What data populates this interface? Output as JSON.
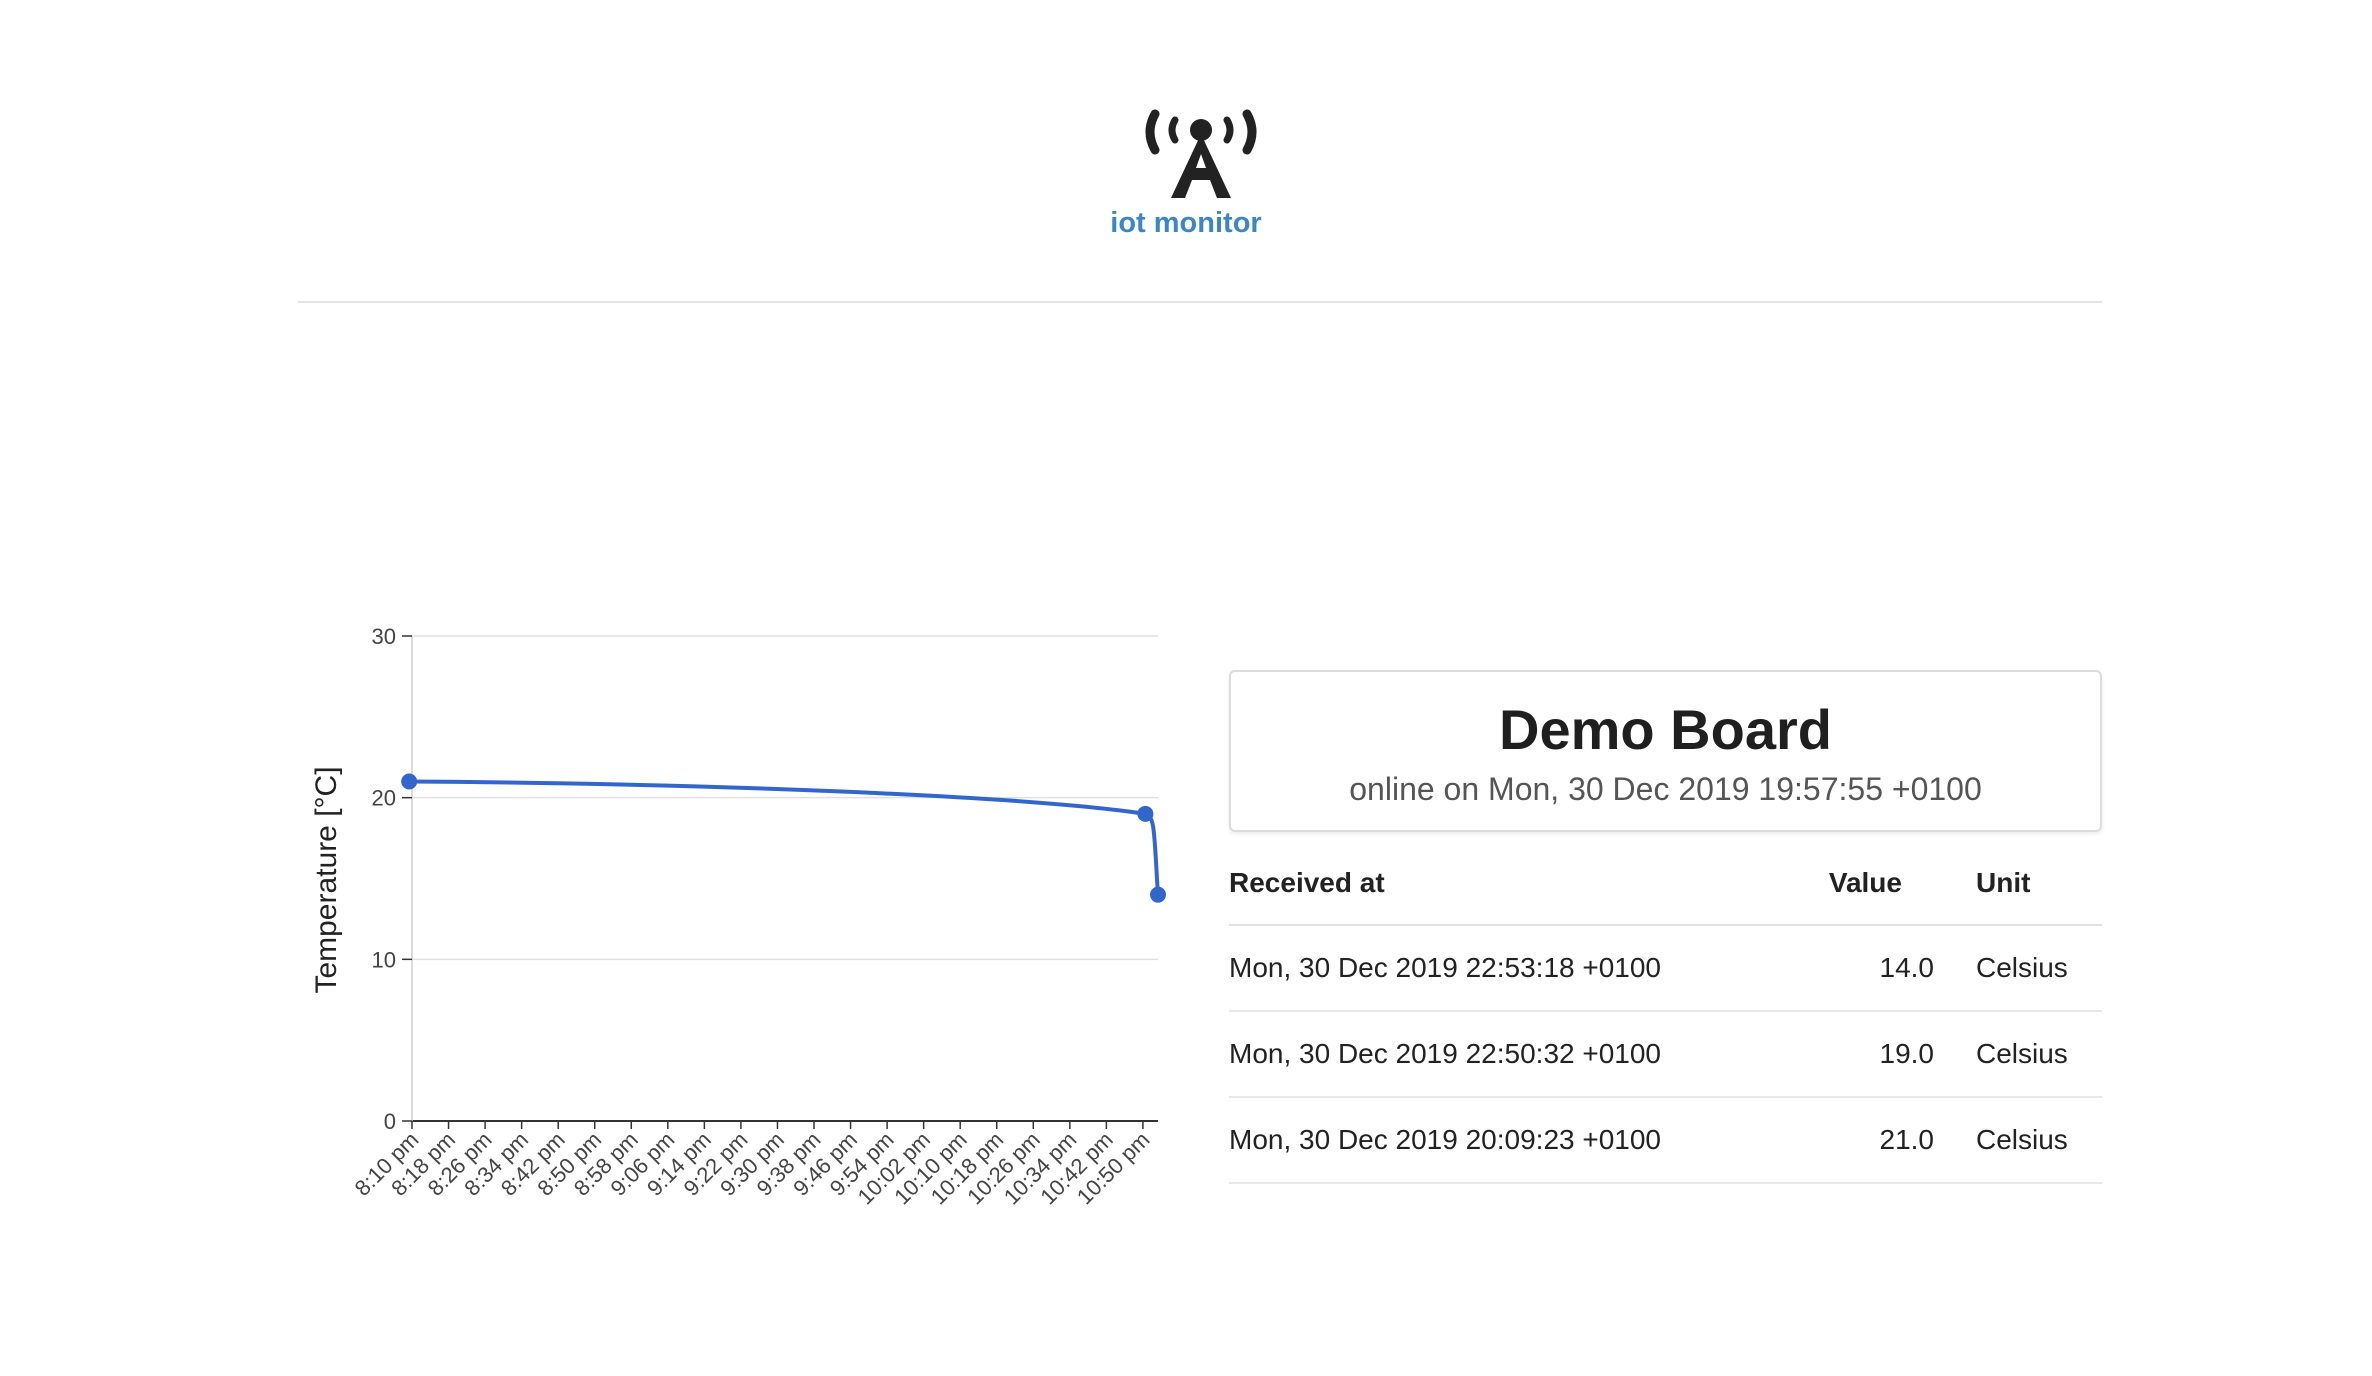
{
  "header": {
    "brand": "iot monitor",
    "logo_icon": "antenna-tower-icon",
    "accent_color": "#3d85c6"
  },
  "device": {
    "name": "Demo Board",
    "status": "online on Mon, 30 Dec 2019 19:57:55 +0100"
  },
  "table": {
    "headers": {
      "received_at": "Received at",
      "value": "Value",
      "unit": "Unit"
    },
    "rows": [
      {
        "received_at": "Mon, 30 Dec 2019 22:53:18 +0100",
        "value": "14.0",
        "unit": "Celsius"
      },
      {
        "received_at": "Mon, 30 Dec 2019 22:50:32 +0100",
        "value": "19.0",
        "unit": "Celsius"
      },
      {
        "received_at": "Mon, 30 Dec 2019 20:09:23 +0100",
        "value": "21.0",
        "unit": "Celsius"
      }
    ]
  },
  "chart_data": {
    "type": "line",
    "title": "",
    "xlabel": "",
    "ylabel": "Temperature [°C]",
    "ylim": [
      0,
      30
    ],
    "yticks": [
      0,
      10,
      20,
      30
    ],
    "xticks": [
      "8:10 pm",
      "8:18 pm",
      "8:26 pm",
      "8:34 pm",
      "8:42 pm",
      "8:50 pm",
      "8:58 pm",
      "9:06 pm",
      "9:14 pm",
      "9:22 pm",
      "9:30 pm",
      "9:38 pm",
      "9:46 pm",
      "9:54 pm",
      "10:02 pm",
      "10:10 pm",
      "10:18 pm",
      "10:26 pm",
      "10:34 pm",
      "10:42 pm",
      "10:50 pm"
    ],
    "series": [
      {
        "x": [
          "20:09:23",
          "22:50:32",
          "22:53:18"
        ],
        "values": [
          21.0,
          19.0,
          14.0
        ],
        "color": "#3366cc"
      }
    ],
    "grid": true,
    "legend": "none"
  }
}
